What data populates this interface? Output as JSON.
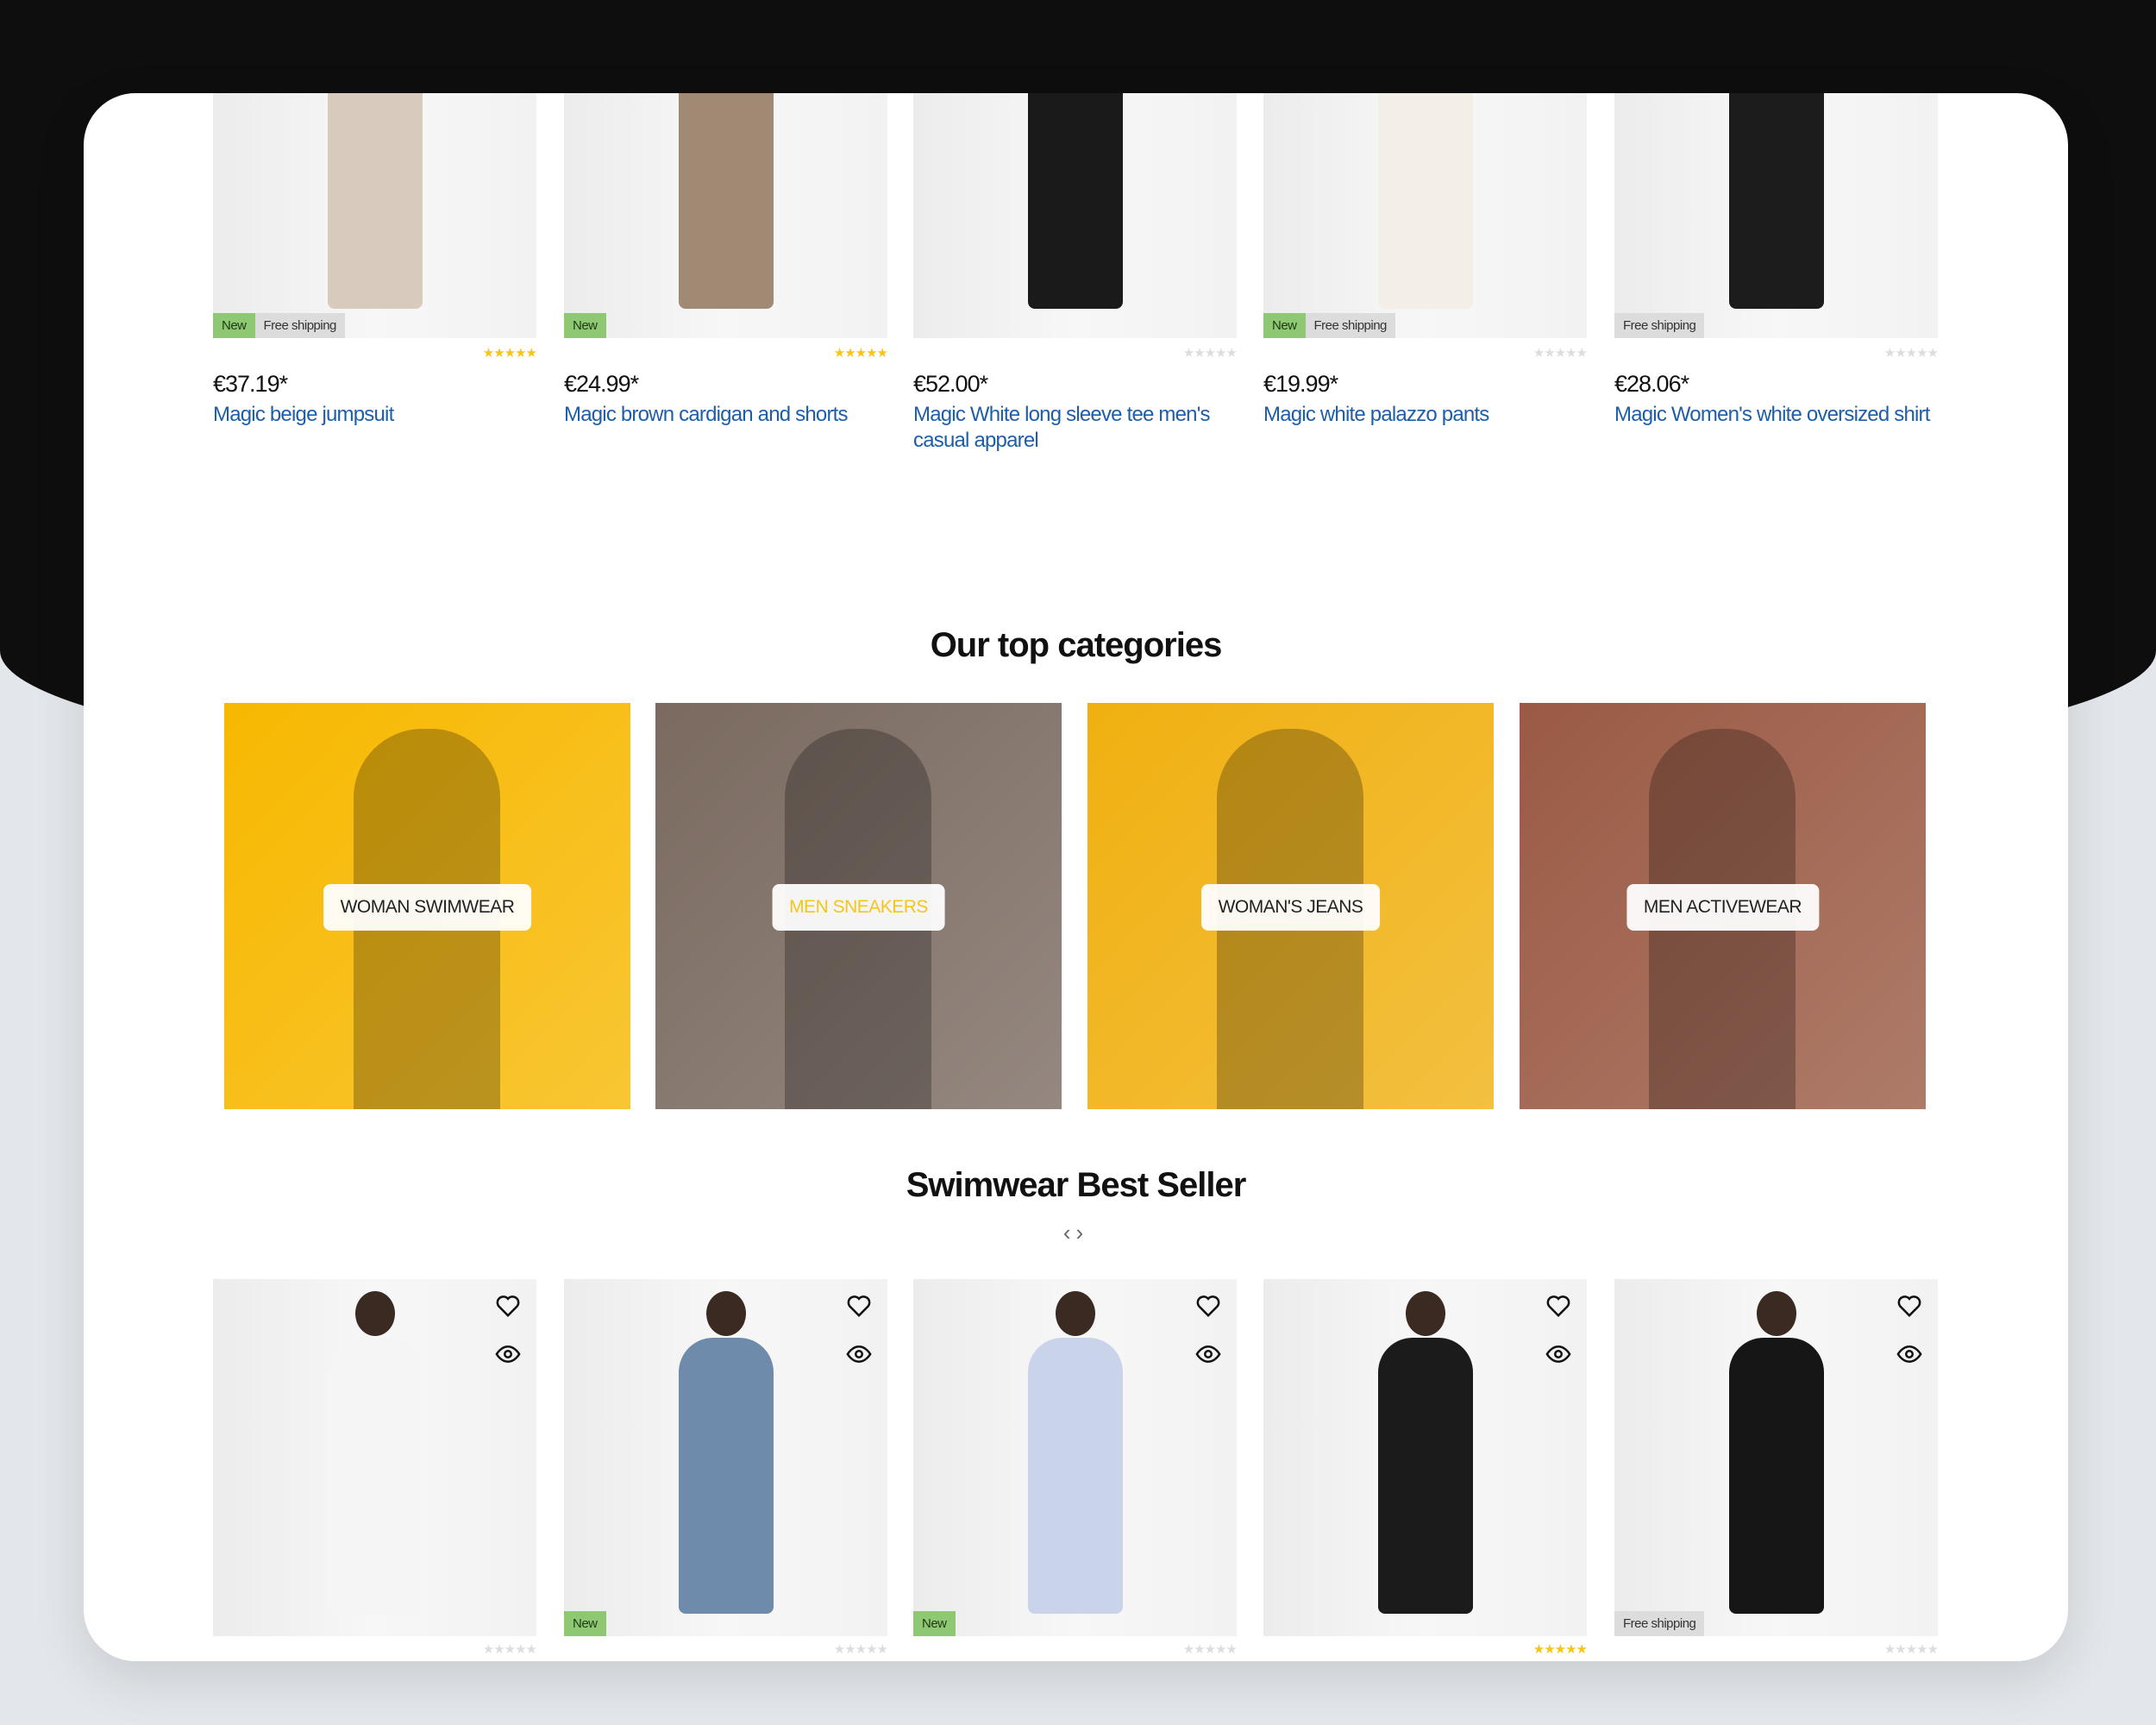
{
  "top_products": [
    {
      "name": "Magic beige jumpsuit",
      "price": "€37.19*",
      "badges": [
        "New",
        "Free shipping"
      ],
      "rating": 5,
      "figure_color": "#d8cbbd"
    },
    {
      "name": "Magic brown cardigan and shorts",
      "price": "€24.99*",
      "badges": [
        "New"
      ],
      "rating": 5,
      "figure_color": "#a08a73"
    },
    {
      "name": "Magic White long sleeve tee men's casual apparel",
      "price": "€52.00*",
      "badges": [],
      "rating": 0,
      "figure_color": "#1a1a1a"
    },
    {
      "name": "Magic white palazzo pants",
      "price": "€19.99*",
      "badges": [
        "New",
        "Free shipping"
      ],
      "rating": 0,
      "figure_color": "#f3efe6"
    },
    {
      "name": "Magic Women's white oversized shirt",
      "price": "€28.06*",
      "badges": [
        "Free shipping"
      ],
      "rating": 0,
      "figure_color": "#1c1c1c"
    }
  ],
  "categories_section": {
    "title": "Our top categories"
  },
  "categories": [
    {
      "label": "WOMAN SWIMWEAR",
      "bg": "#f7b800",
      "hover": false
    },
    {
      "label": "MEN SNEAKERS",
      "bg": "#7a6a60",
      "hover": true
    },
    {
      "label": "WOMAN'S JEANS",
      "bg": "#f0b010",
      "hover": false
    },
    {
      "label": "MEN ACTIVEWEAR",
      "bg": "#9a5a44",
      "hover": false
    }
  ],
  "bestseller": {
    "title": "Swimwear Best Seller",
    "prev": "‹",
    "next": "›"
  },
  "bottom_products": [
    {
      "badges": [],
      "rating": 0,
      "figure_color": "#f5f5f5"
    },
    {
      "badges": [
        "New"
      ],
      "rating": 0,
      "figure_color": "#6f8bab"
    },
    {
      "badges": [
        "New"
      ],
      "rating": 0,
      "figure_color": "#c9d3ea"
    },
    {
      "badges": [],
      "rating": 5,
      "figure_color": "#1b1b1b"
    },
    {
      "badges": [
        "Free shipping"
      ],
      "rating": 0,
      "figure_color": "#161616"
    }
  ],
  "colors": {
    "link": "#1e5ea8",
    "badge_new": "#8fc873",
    "star_on": "#f5c518",
    "star_off": "#dddddd",
    "hover_label": "#f5c518"
  }
}
